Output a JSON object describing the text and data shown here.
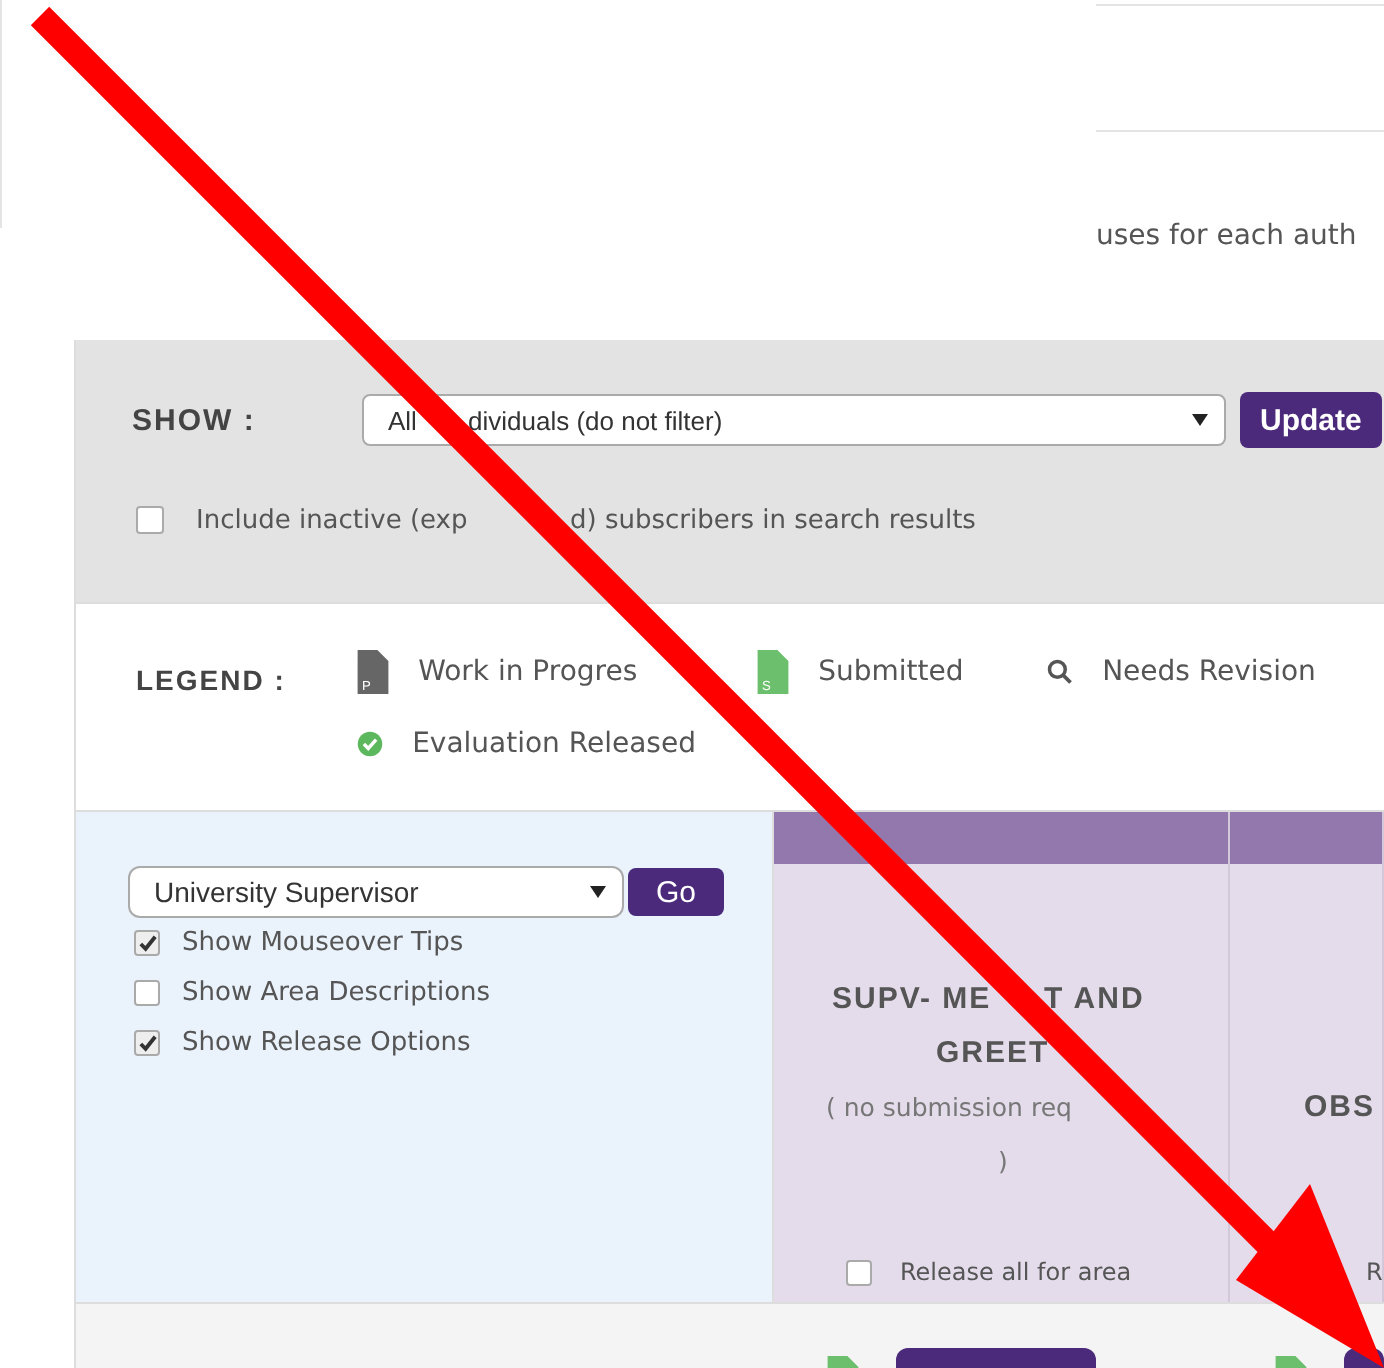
{
  "intro_text": "uses for each auth",
  "filter": {
    "label": "SHOW :",
    "select_value_parts": [
      "All",
      "dividuals (do not filter)"
    ],
    "button": "Update",
    "include_inactive": {
      "label_parts": [
        "Include inactive (exp",
        "d) subscribers in search results"
      ],
      "checked": false
    }
  },
  "legend": {
    "label": "LEGEND :",
    "items": [
      {
        "kind": "wip",
        "label": "Work in Progres",
        "glyph": "P"
      },
      {
        "kind": "submitted",
        "label": "Submitted",
        "glyph": "S"
      },
      {
        "kind": "revision",
        "label": "Needs Revision"
      },
      {
        "kind": "released",
        "label": "Evaluation Released"
      }
    ]
  },
  "options": {
    "role_select": "University Supervisor",
    "go_button": "Go",
    "checks": [
      {
        "label": "Show Mouseover Tips",
        "checked": true
      },
      {
        "label": "Show Area Descriptions",
        "checked": false
      },
      {
        "label": "Show Release Options",
        "checked": true
      }
    ]
  },
  "columns": [
    {
      "title_lines": [
        [
          "SUPV- ME",
          "T AND"
        ],
        [
          "GREET"
        ]
      ],
      "note_lines": [
        "( no submission req",
        ")"
      ],
      "release_label": "Release all for area",
      "release_checked": false
    },
    {
      "title_lines": [
        [
          "OBS"
        ]
      ],
      "release_label": "R"
    }
  ]
}
